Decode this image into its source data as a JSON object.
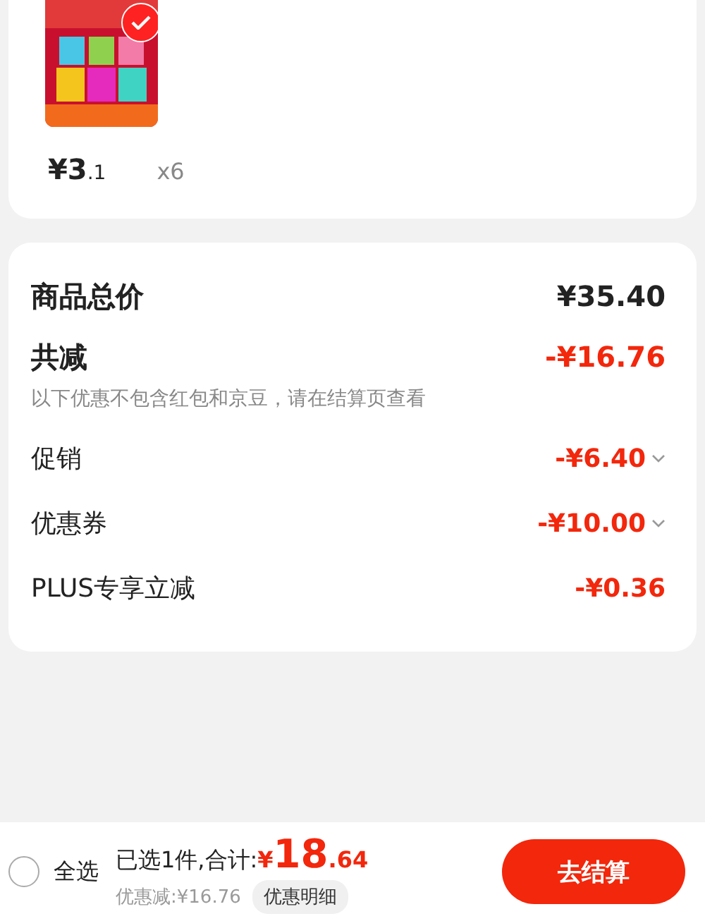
{
  "product": {
    "selected": true,
    "price_integer": "¥3",
    "price_decimal": ".1",
    "quantity": "x6"
  },
  "summary": {
    "total_label": "商品总价",
    "total_value": "¥35.40",
    "discount_label": "共减",
    "discount_value": "-¥16.76",
    "note": "以下优惠不包含红包和京豆，请在结算页查看",
    "items": [
      {
        "label": "促销",
        "value": "-¥6.40",
        "expandable": true
      },
      {
        "label": "优惠券",
        "value": "-¥10.00",
        "expandable": true
      },
      {
        "label": "PLUS专享立减",
        "value": "-¥0.36",
        "expandable": false
      }
    ]
  },
  "footer": {
    "select_all": {
      "label": "全选",
      "checked": false
    },
    "selected_text": "已选1件,合计:",
    "total_currency": "¥",
    "total_integer": "18",
    "total_decimal": ".64",
    "saved": "优惠减:¥16.76",
    "details_button": "优惠明细",
    "checkout_button": "去结算"
  }
}
